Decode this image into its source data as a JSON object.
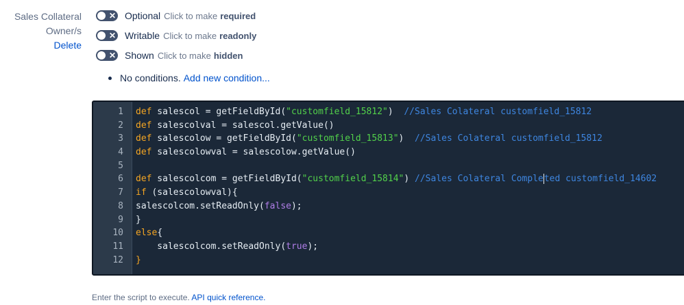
{
  "field": {
    "name_line1": "Sales Collateral",
    "name_line2": "Owner/s",
    "delete_label": "Delete"
  },
  "toggles": [
    {
      "state": "Optional",
      "hint": "Click to make",
      "action": "required"
    },
    {
      "state": "Writable",
      "hint": "Click to make",
      "action": "readonly"
    },
    {
      "state": "Shown",
      "hint": "Click to make",
      "action": "hidden"
    }
  ],
  "conditions": {
    "text": "No conditions.",
    "add_link": "Add new condition..."
  },
  "editor": {
    "line_numbers": [
      "1",
      "2",
      "3",
      "4",
      "5",
      "6",
      "7",
      "8",
      "9",
      "10",
      "11",
      "12"
    ],
    "l1": {
      "a": "def",
      "b": " salescol = getFieldById(",
      "c": "\"customfield_15812\"",
      "d": ")  ",
      "e": "//Sales Colateral customfield_15812"
    },
    "l2": {
      "a": "def",
      "b": " salescolval = salescol.getValue()"
    },
    "l3": {
      "a": "def",
      "b": " salescolow = getFieldById(",
      "c": "\"customfield_15813\"",
      "d": ")  ",
      "e": "//Sales Colateral customfield_15812"
    },
    "l4": {
      "a": "def",
      "b": " salescolowval = salescolow.getValue()"
    },
    "l6": {
      "a": "def",
      "b": " salescolcom = getFieldById(",
      "c": "\"customfield_15814\"",
      "d": ") ",
      "e1": "//Sales Colateral Comple",
      "e2": "ted customfield_14602"
    },
    "l7": {
      "a": "if",
      "b": " (salescolowval){"
    },
    "l8": {
      "a": "salescolcom.setReadOnly(",
      "b": "false",
      "c": ");"
    },
    "l9": {
      "a": "}"
    },
    "l10": {
      "a": "else",
      "b": "{"
    },
    "l11": {
      "a": "    salescolcom.setReadOnly(",
      "b": "true",
      "c": ");"
    },
    "l12": {
      "a": "}"
    }
  },
  "footer": {
    "text": "Enter the script to execute.",
    "link": "API quick reference."
  }
}
